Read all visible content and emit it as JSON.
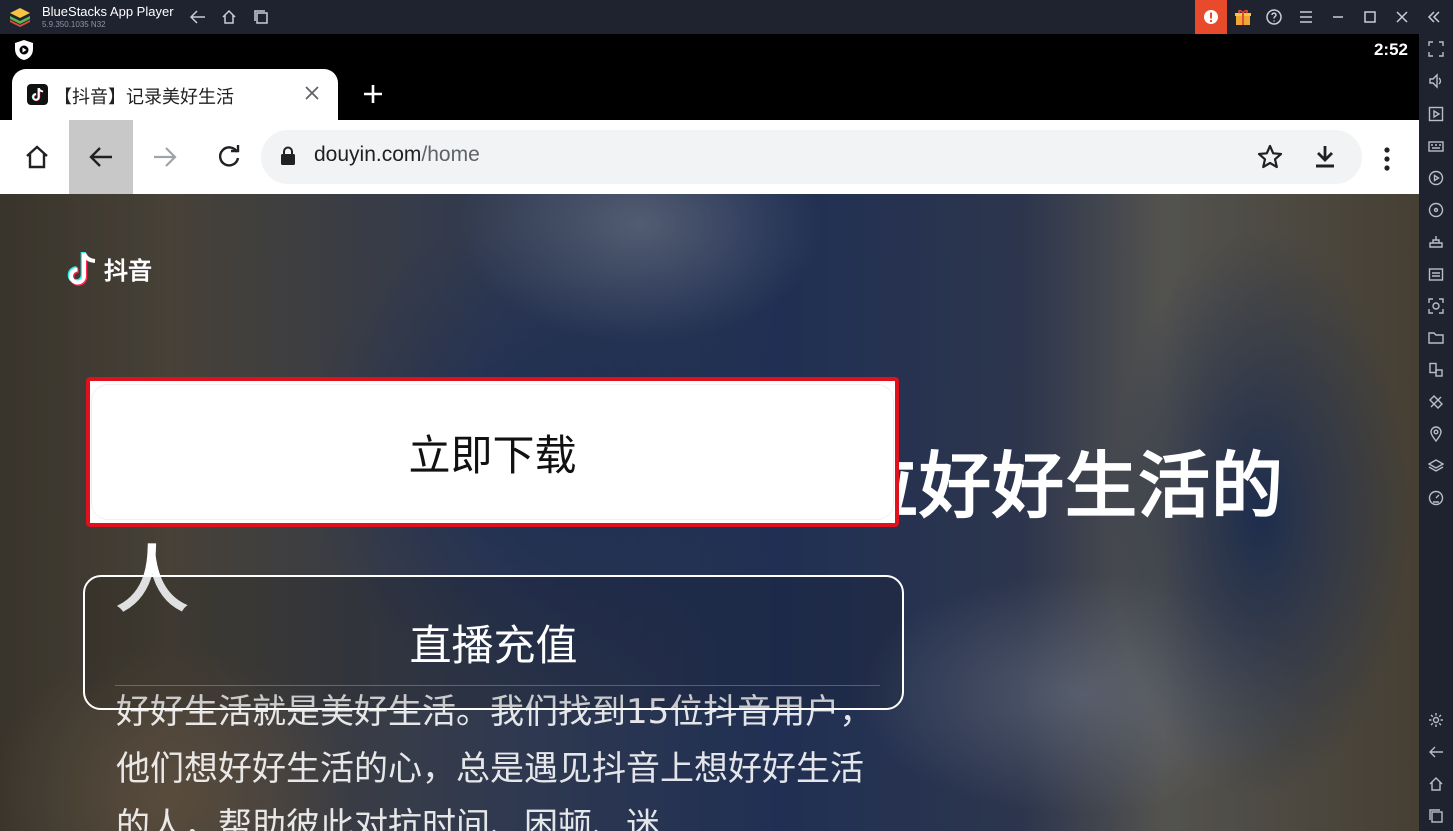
{
  "window": {
    "app_name": "BlueStacks App Player",
    "version": "5.9.350.1035  N32"
  },
  "statusbar": {
    "time": "2:52"
  },
  "browser": {
    "tab_title": "【抖音】记录美好生活",
    "url_host": "douyin.com",
    "url_path": "/home"
  },
  "page": {
    "brand": "抖音",
    "download_button": "立即下载",
    "recharge_button": "直播充值",
    "headline": "抖音生活害就，致每一位好好生活的人",
    "description": "好好生活就是美好生活。我们找到15位抖音用户，他们想好好生活的心，总是遇见抖音上想好好生活的人，帮助彼此对抗时间、困顿、迷"
  },
  "colors": {
    "titlebar_bg": "#1f2330",
    "highlight_border": "#e0101c",
    "notification": "#e84b2c"
  }
}
